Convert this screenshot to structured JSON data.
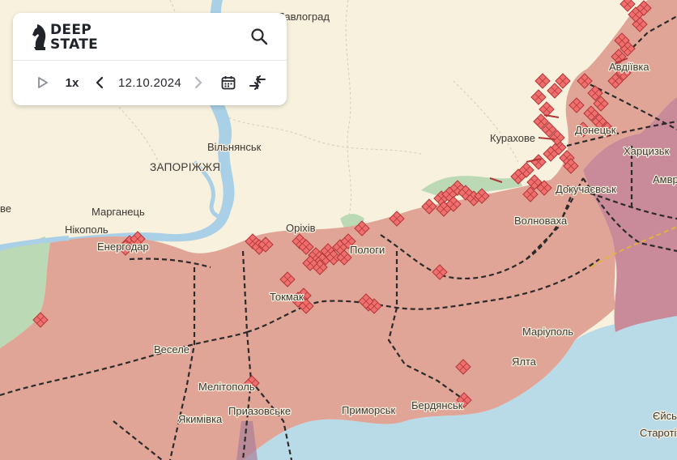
{
  "app": {
    "logo_text_line1": "DEEP",
    "logo_text_line2": "STATE",
    "logo_icon": "knight-chess-icon"
  },
  "toolbar": {
    "play_icon": "play-icon",
    "speed": "1x",
    "prev_icon": "chevron-left-icon",
    "date": "12.10.2024",
    "next_icon": "chevron-right-icon",
    "calendar_icon": "calendar-icon",
    "compare_icon": "compare-arrows-icon",
    "search_icon": "search-icon"
  },
  "map": {
    "labels": {
      "pavlohrad": "Павлоград",
      "zaporizhzhia": "ЗАПОРІЖЖЯ",
      "vilniansk": "Вільнянськ",
      "marhanets": "Марганець",
      "nikopol": "Нікополь",
      "enerhodar": "Енергодар",
      "orikhiv": "Оріхів",
      "polohy": "Пологи",
      "tokmak": "Токмак",
      "vesele": "Веселе",
      "melitopol": "Мелітополь",
      "yakymivka": "Якимівка",
      "pryazovske": "Приазовське",
      "prymorsk": "Приморськ",
      "berdiansk": "Бердянськ",
      "yalta": "Ялта",
      "mariupol": "Маріуполь",
      "volnovakha": "Волноваха",
      "kurakhove": "Курахове",
      "dokuchaievsk": "Докучаєвськ",
      "donetsk": "Донецьк",
      "khartsyzk": "Харцизьк",
      "amvrosiivka": "Амвросіївка",
      "yeisk": "Єйськ",
      "starotitarovka": "Старотітарівська",
      "avdiivka": "Авдіївка",
      "west_edge": "ве"
    },
    "colors": {
      "land": "#f7f1de",
      "occupied": "#e1a597",
      "crimea_old_occupied": "#c98a9a",
      "sea": "#b9dbe8",
      "river": "#a9d0e6",
      "green_liberated": "#bcd9b5",
      "marker_fill": "#ef6f6f",
      "marker_stroke": "#b23535",
      "front_road": "#2a2a2a"
    }
  }
}
